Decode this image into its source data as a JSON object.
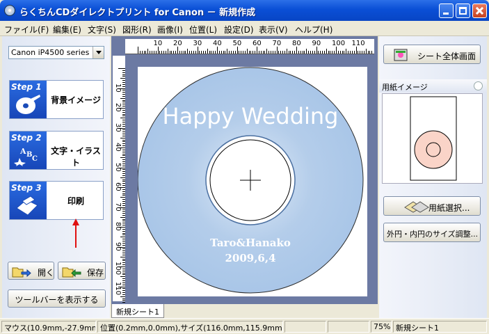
{
  "window": {
    "title": "らくちんCDダイレクトプリント for Canon － 新規作成"
  },
  "menu": [
    "ファイル(F)",
    "編集(E)",
    "文字(S)",
    "図形(R)",
    "画像(I)",
    "位置(L)",
    "設定(D)",
    "表示(V)",
    "ヘルプ(H)"
  ],
  "left_panel": {
    "printer": "Canon iP4500 series",
    "steps": [
      {
        "label": "Step 1",
        "text": "背景イメージ"
      },
      {
        "label": "Step 2",
        "text": "文字・イラスト"
      },
      {
        "label": "Step 3",
        "text": "印刷"
      }
    ],
    "open_label": "開く",
    "save_label": "保存",
    "toolbar_label": "ツールバーを表示する"
  },
  "canvas": {
    "ruler_h": [
      "10",
      "20",
      "30",
      "40",
      "50",
      "60",
      "70",
      "80",
      "90",
      "100",
      "110"
    ],
    "ruler_v": [
      "10",
      "20",
      "30",
      "40",
      "50",
      "60",
      "70",
      "80",
      "90",
      "100",
      "110"
    ],
    "disc_title": "Happy Wedding",
    "disc_names": "Taro&Hanako",
    "disc_date": "2009,6,4",
    "colors": {
      "disc": "#b9d3ef",
      "disc_edge": "#8fb3dd"
    }
  },
  "sheet_tab": "新規シート1",
  "right_panel": {
    "fullview_label": "シート全体画面",
    "paper_image_label": "用紙イメージ",
    "paper_select_label": "用紙選択...",
    "size_adjust_label": "外円・内円のサイズ調整..."
  },
  "status": {
    "mouse": "マウス(10.9mm,-27.9mm)",
    "position": "位置(0.2mm,0.0mm),サイズ(116.0mm,115.9mm)",
    "zoom": "75%",
    "sheet": "新規シート1"
  }
}
